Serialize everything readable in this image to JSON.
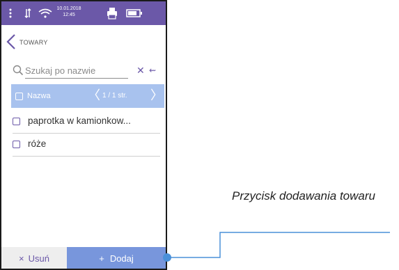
{
  "status_bar": {
    "date": "10.01.2018",
    "time": "12:45",
    "icons": [
      "more-vert-icon",
      "data-transfer-icon",
      "wifi-icon",
      "printer-icon",
      "battery-icon"
    ]
  },
  "header": {
    "title": "TOWARY"
  },
  "search": {
    "placeholder": "Szukaj po nazwie"
  },
  "list_header": {
    "column_label": "Nazwa",
    "pagination": "1 / 1 str."
  },
  "items": [
    {
      "label": "paprotka w kamionkow..."
    },
    {
      "label": "róże"
    }
  ],
  "buttons": {
    "delete_label": "Usuń",
    "delete_icon": "×",
    "add_label": "Dodaj",
    "add_icon": "+"
  },
  "callout": {
    "text": "Przycisk dodawania towaru"
  },
  "colors": {
    "statusbar": "#6b58a8",
    "accent": "#6b58a8",
    "list_header": "#a8c2ee",
    "add_button": "#7896dc",
    "leader_line": "#4a90d9"
  }
}
